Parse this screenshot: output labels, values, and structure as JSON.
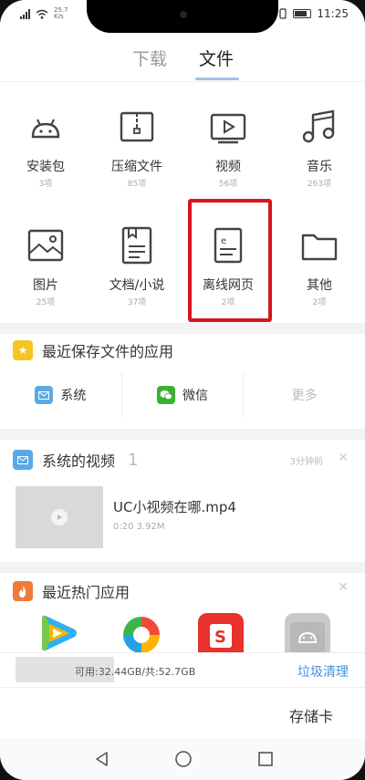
{
  "status_bar": {
    "speed_value": "25.7",
    "speed_unit": "K/s",
    "time": "11:25"
  },
  "tabs": [
    {
      "label": "下载"
    },
    {
      "label": "文件"
    }
  ],
  "categories": [
    {
      "name": "安装包",
      "count": "3项",
      "icon": "android-icon"
    },
    {
      "name": "压缩文件",
      "count": "85项",
      "icon": "archive-icon"
    },
    {
      "name": "视频",
      "count": "56项",
      "icon": "video-icon"
    },
    {
      "name": "音乐",
      "count": "263项",
      "icon": "music-icon"
    },
    {
      "name": "图片",
      "count": "25项",
      "icon": "image-icon"
    },
    {
      "name": "文档/小说",
      "count": "37项",
      "icon": "document-icon"
    },
    {
      "name": "离线网页",
      "count": "2项",
      "icon": "offline-page-icon"
    },
    {
      "name": "其他",
      "count": "2项",
      "icon": "folder-icon"
    }
  ],
  "recent_saved": {
    "title": "最近保存文件的应用",
    "apps": [
      {
        "label": "系统"
      },
      {
        "label": "微信"
      },
      {
        "label": "更多"
      }
    ]
  },
  "system_videos": {
    "title": "系统的视频",
    "count": "1",
    "time_ago": "3分钟前",
    "video_name": "UC小视频在哪.mp4",
    "video_meta": "0:20  3.92M"
  },
  "hot_apps": {
    "title": "最近热门应用"
  },
  "storage": {
    "text": "可用:32.44GB/共:52.7GB",
    "clean_label": "垃圾清理",
    "used_fraction": 0.38
  },
  "sdcard_label": "存储卡",
  "colors": {
    "highlight": "#d8141e",
    "accent_blue": "#4a90d9",
    "star_badge": "#f5c623",
    "video_badge": "#5aa9e6",
    "hot_badge": "#f07a3a",
    "wechat_green": "#3cb034"
  }
}
